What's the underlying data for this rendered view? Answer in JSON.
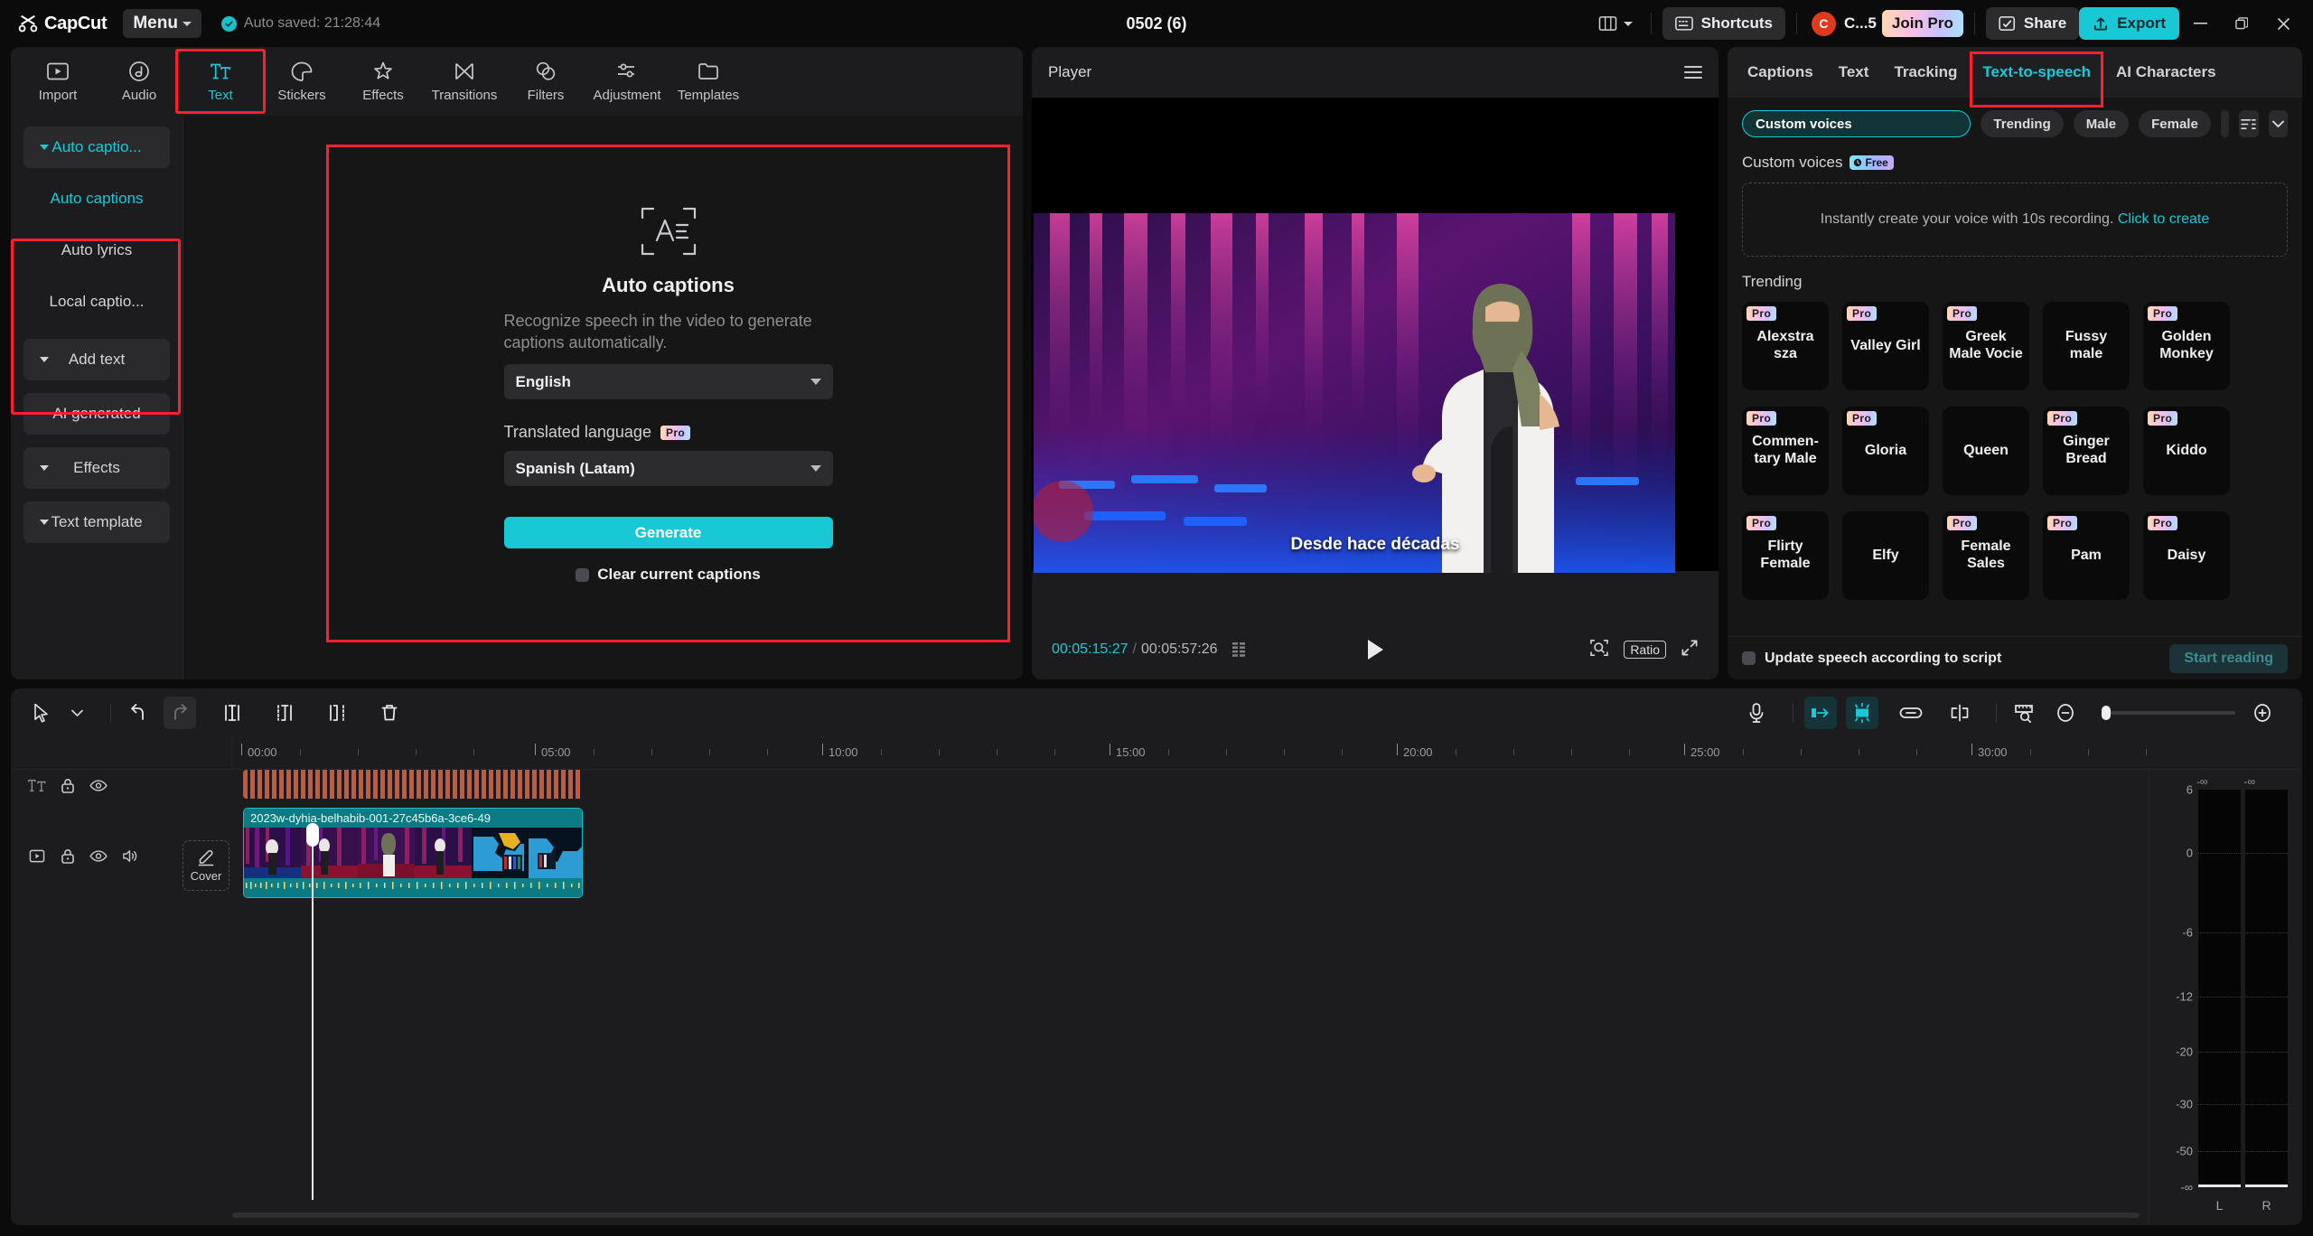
{
  "titlebar": {
    "brand": "CapCut",
    "menu_label": "Menu",
    "autosave": "Auto saved: 21:28:44",
    "project_title": "0502 (6)",
    "shortcuts_label": "Shortcuts",
    "account_name": "C...5",
    "account_initial": "C",
    "join_pro_label": "Join Pro",
    "share_label": "Share",
    "export_label": "Export",
    "minimize_icon": "minimize-icon",
    "restore_icon": "restore-icon",
    "close_icon": "close-icon",
    "layout_icon": "layout-icon"
  },
  "left_tabs": [
    {
      "label": "Import",
      "icon": "import-icon",
      "active": false
    },
    {
      "label": "Audio",
      "icon": "audio-icon",
      "active": false
    },
    {
      "label": "Text",
      "icon": "text-icon",
      "active": true
    },
    {
      "label": "Stickers",
      "icon": "stickers-icon",
      "active": false
    },
    {
      "label": "Effects",
      "icon": "effects-icon",
      "active": false
    },
    {
      "label": "Transitions",
      "icon": "transitions-icon",
      "active": false
    },
    {
      "label": "Filters",
      "icon": "filters-icon",
      "active": false
    },
    {
      "label": "Adjustment",
      "icon": "adjustment-icon",
      "active": false
    },
    {
      "label": "Templates",
      "icon": "templates-icon",
      "active": false
    }
  ],
  "left_sidebar": [
    {
      "label": "Auto captio...",
      "accent": true,
      "caret": true,
      "filled": true
    },
    {
      "label": "Auto captions",
      "accent": true,
      "caret": false,
      "filled": false
    },
    {
      "label": "Auto lyrics",
      "accent": false,
      "caret": false,
      "filled": false
    },
    {
      "label": "Local captio...",
      "accent": false,
      "caret": false,
      "filled": false
    },
    {
      "label": "Add text",
      "accent": false,
      "caret": true,
      "filled": true
    },
    {
      "label": "AI generated",
      "accent": false,
      "caret": false,
      "filled": true
    },
    {
      "label": "Effects",
      "accent": false,
      "caret": true,
      "filled": true
    },
    {
      "label": "Text template",
      "accent": false,
      "caret": true,
      "filled": true
    }
  ],
  "auto_captions": {
    "icon": "auto-captions-icon",
    "title": "Auto captions",
    "description": "Recognize speech in the video to generate captions automatically.",
    "source_language": "English",
    "translated_label": "Translated language",
    "pro_badge": "Pro",
    "translated_language": "Spanish (Latam)",
    "generate_label": "Generate",
    "clear_label": "Clear current captions"
  },
  "player": {
    "title": "Player",
    "caption": "Desde hace décadas",
    "current_time": "00:05:15:27",
    "total_time": "00:05:57:26",
    "ratio_label": "Ratio",
    "menu_icon": "player-menu-icon",
    "play_icon": "play-icon",
    "keyframe_icon": "keyframe-list-icon",
    "zoom_icon": "magnify-icon",
    "fullscreen_icon": "fullscreen-icon"
  },
  "right_panel": {
    "tabs": [
      {
        "label": "Captions",
        "active": false
      },
      {
        "label": "Text",
        "active": false
      },
      {
        "label": "Tracking",
        "active": false
      },
      {
        "label": "Text-to-speech",
        "active": true
      },
      {
        "label": "AI Characters",
        "active": false
      }
    ],
    "filters": [
      {
        "label": "Custom voices",
        "selected": true
      },
      {
        "label": "Trending",
        "selected": false
      },
      {
        "label": "Male",
        "selected": false
      },
      {
        "label": "Female",
        "selected": false
      }
    ],
    "filter_icon": "filter-icon",
    "expand_icon": "chevron-down-icon",
    "custom_voices_title": "Custom voices",
    "free_badge": "Free",
    "promo_text": "Instantly create your voice with 10s recording.",
    "promo_link": "Click to create",
    "trending_title": "Trending",
    "voices": [
      {
        "name": "Alexstra sza",
        "pro": true
      },
      {
        "name": "Valley Girl",
        "pro": true
      },
      {
        "name": "Greek Male Vocie",
        "pro": true
      },
      {
        "name": "Fussy male",
        "pro": false
      },
      {
        "name": "Golden Monkey",
        "pro": true
      },
      {
        "name": "Commen- tary Male",
        "pro": true
      },
      {
        "name": "Gloria",
        "pro": true
      },
      {
        "name": "Queen",
        "pro": false
      },
      {
        "name": "Ginger Bread",
        "pro": true
      },
      {
        "name": "Kiddo",
        "pro": true
      },
      {
        "name": "Flirty Female",
        "pro": true
      },
      {
        "name": "Elfy",
        "pro": false
      },
      {
        "name": "Female Sales",
        "pro": true
      },
      {
        "name": "Pam",
        "pro": true
      },
      {
        "name": "Daisy",
        "pro": true
      }
    ],
    "pro_badge": "Pro",
    "update_speech_label": "Update speech according to script",
    "start_reading_label": "Start reading"
  },
  "timeline": {
    "tools": [
      {
        "name": "select-tool-icon",
        "state": "normal"
      },
      {
        "name": "tool-dropdown-icon",
        "state": "normal"
      },
      {
        "name": "undo-icon",
        "state": "normal"
      },
      {
        "name": "redo-icon",
        "state": "boxed"
      },
      {
        "name": "split-icon",
        "state": "normal"
      },
      {
        "name": "trim-left-icon",
        "state": "normal"
      },
      {
        "name": "trim-right-icon",
        "state": "normal"
      },
      {
        "name": "delete-icon",
        "state": "normal"
      }
    ],
    "right_tools": [
      {
        "name": "microphone-icon",
        "state": "normal"
      },
      {
        "name": "auto-cut-icon",
        "state": "active"
      },
      {
        "name": "keyframe-icon",
        "state": "active"
      },
      {
        "name": "link-icon",
        "state": "normal"
      },
      {
        "name": "snap-icon",
        "state": "normal"
      },
      {
        "name": "ruler-icon",
        "state": "normal"
      },
      {
        "name": "zoom-out-icon",
        "state": "normal"
      },
      {
        "name": "zoom-in-icon",
        "state": "normal"
      }
    ],
    "ruler_labels": [
      "00:00",
      "05:00",
      "10:00",
      "15:00",
      "20:00",
      "25:00",
      "30:00"
    ],
    "tracks": [
      {
        "type": "text",
        "icons": [
          "text-track-icon",
          "lock-icon",
          "eye-icon"
        ],
        "clip_label": ""
      },
      {
        "type": "video",
        "icons": [
          "video-track-icon",
          "lock-icon",
          "eye-icon",
          "speaker-icon"
        ],
        "clip_label": "2023w-dyhia-belhabib-001-27c45b6a-3ce6-49"
      }
    ],
    "cover_label": "Cover",
    "meter": {
      "top_values": [
        "-∞",
        "-∞"
      ],
      "scale": [
        "6",
        "0",
        "-6",
        "-12",
        "-20",
        "-30",
        "-50",
        "-∞"
      ],
      "channels": [
        "L",
        "R"
      ]
    }
  }
}
